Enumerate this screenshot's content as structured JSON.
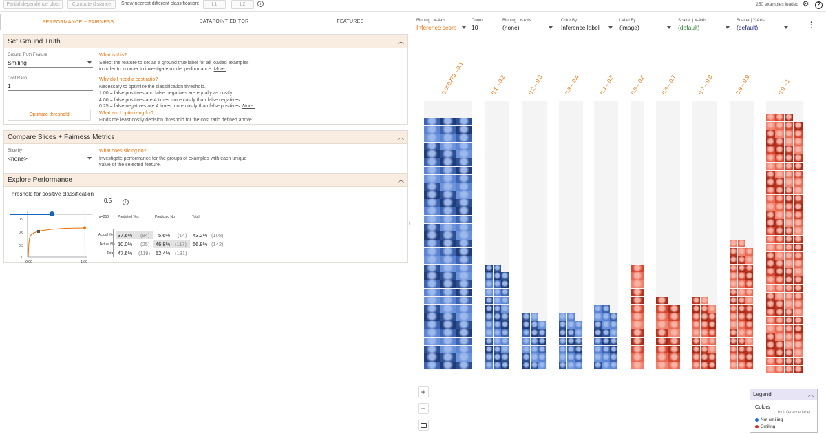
{
  "toolbar": {
    "partial_dependence": "Partial dependence plots",
    "compute_distance": "Compute distance",
    "nearest_label": "Show nearest different classification:",
    "l1": "L1",
    "l2": "L2",
    "examples_loaded": "250 examples loaded"
  },
  "tabs": [
    {
      "label": "PERFORMANCE + FAIRNESS",
      "active": true
    },
    {
      "label": "DATAPOINT EDITOR",
      "active": false
    },
    {
      "label": "FEATURES",
      "active": false
    }
  ],
  "ground_truth": {
    "title": "Set Ground Truth",
    "feature_label": "Ground Truth Feature",
    "feature_value": "Smiling",
    "cost_label": "Cost Ratio",
    "cost_value": "1",
    "optimize_button": "Optimize threshold",
    "what_title": "What is this?",
    "what_line1": "Select the feature to set as a ground true label for all loaded examples",
    "what_line2": "in order to in order to investigate model performance.",
    "more": "More.",
    "why_title": "Why do I need a cost ratio?",
    "why_line1": "Necessary to optimize the classification threshold.",
    "why_line2": "1.00 = false positives and false negatives are equally as costly",
    "why_line3": "4.00 = false positives are 4 times more costly than false negatives",
    "why_line4": "0.25 = false negatives are 4 times more costly than false positives.",
    "optimizing_title": "What am I optimizing for?",
    "optimizing_line": "Finds the least costly decision threshold for the cost ratio defined above."
  },
  "slices": {
    "title": "Compare Slices + Fairness Metrics",
    "slice_label": "Slice by",
    "slice_value": "<none>",
    "help_title": "What does slicing do?",
    "help_line1": "Investigate performance for the groups of examples with each unique",
    "help_line2": "value of the selected feature."
  },
  "explore": {
    "title": "Explore Performance",
    "threshold_label": "Threshold for positive classification",
    "threshold_value": "0.5",
    "threshold": 0.5,
    "roc_ticks_y": [
      "0.9",
      "0.6",
      "0.3",
      "0"
    ],
    "roc_ticks_x": [
      "0.00",
      "1.00"
    ],
    "table": {
      "n": "n=250",
      "col_pred_yes": "Predicted Yes",
      "col_pred_no": "Predicted No",
      "col_total": "Total",
      "row_actual_yes": "Actual Yes",
      "row_actual_no": "Actual No",
      "row_total": "Total",
      "r1": {
        "yes_pct": "37.6%",
        "yes_n": "(94)",
        "no_pct": "5.6%",
        "no_n": "(14)",
        "tot_pct": "43.2%",
        "tot_n": "(108)"
      },
      "r2": {
        "yes_pct": "10.0%",
        "yes_n": "(25)",
        "no_pct": "46.8%",
        "no_n": "(117)",
        "tot_pct": "56.8%",
        "tot_n": "(142)"
      },
      "r3": {
        "yes_pct": "47.6%",
        "yes_n": "(119)",
        "no_pct": "52.4%",
        "no_n": "(131)"
      }
    }
  },
  "controls": [
    {
      "label": "Binning | X-Axis",
      "value": "Inference score",
      "color": "orange"
    },
    {
      "label": "Count",
      "value": "10",
      "color": "dark"
    },
    {
      "label": "Binning | Y-Axis",
      "value": "(none)",
      "color": "dark"
    },
    {
      "label": "Color By",
      "value": "Inference label",
      "color": "dark"
    },
    {
      "label": "Label By",
      "value": "(image)",
      "color": "dark"
    },
    {
      "label": "Scatter | X-Axis",
      "value": "(default)",
      "color": "green"
    },
    {
      "label": "Scatter | Y-Axis",
      "value": "(default)",
      "color": "navy"
    }
  ],
  "bins": [
    {
      "label": "0.000275 – 0.1",
      "rows": 31,
      "cols": 3,
      "color": "blue"
    },
    {
      "label": "0.1 – 0.2",
      "rows": 13,
      "cols": 3,
      "color": "blue"
    },
    {
      "label": "0.2 – 0.3",
      "rows": 7,
      "cols": 3,
      "color": "blue"
    },
    {
      "label": "0.3 – 0.4",
      "rows": 7,
      "cols": 3,
      "color": "blue"
    },
    {
      "label": "0.4 – 0.5",
      "rows": 8,
      "cols": 3,
      "color": "blue"
    },
    {
      "label": "0.5 – 0.6",
      "rows": 13,
      "cols": 1,
      "color": "red"
    },
    {
      "label": "0.6 – 0.7",
      "rows": 9,
      "cols": 2,
      "color": "red"
    },
    {
      "label": "0.7 – 0.8",
      "rows": 9,
      "cols": 3,
      "color": "red"
    },
    {
      "label": "0.8 – 0.9",
      "rows": 16,
      "cols": 3,
      "color": "red"
    },
    {
      "label": "0.9 – 1",
      "rows": 32,
      "cols": 4,
      "color": "red"
    }
  ],
  "colors": {
    "blue": "#4a76c9",
    "red": "#e0503a",
    "accent": "#e8710a"
  },
  "legend": {
    "title": "Legend",
    "colors_label": "Colors",
    "by_label": "by Inference label",
    "items": [
      {
        "label": "Not smiling",
        "color": "#1e6fd9"
      },
      {
        "label": "Smiling",
        "color": "#d93025"
      }
    ]
  }
}
